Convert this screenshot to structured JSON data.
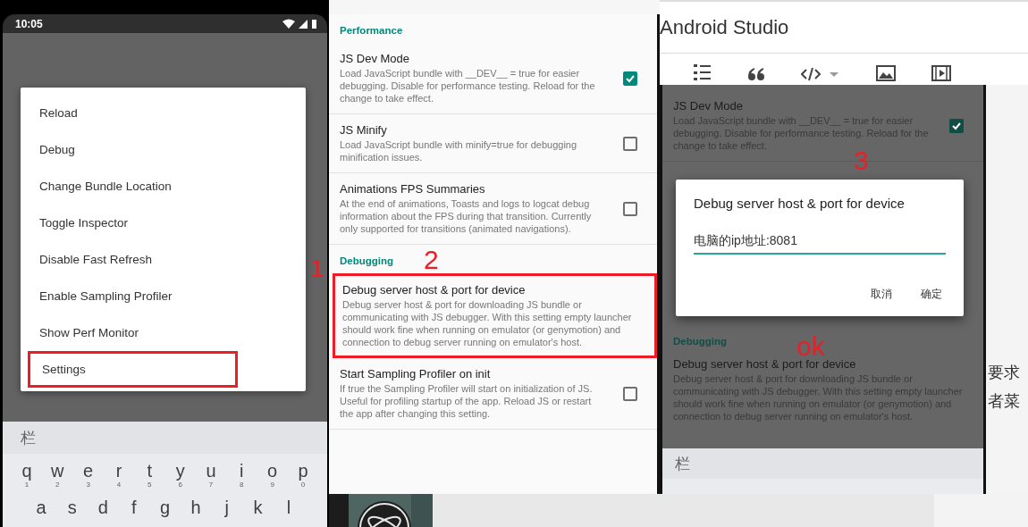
{
  "menu_screen": {
    "status_bar": {
      "time": "10:05"
    },
    "menu_items": [
      {
        "label": "Reload",
        "highlighted": false
      },
      {
        "label": "Debug",
        "highlighted": false
      },
      {
        "label": "Change Bundle Location",
        "highlighted": false
      },
      {
        "label": "Toggle Inspector",
        "highlighted": false
      },
      {
        "label": "Disable Fast Refresh",
        "highlighted": false
      },
      {
        "label": "Enable Sampling Profiler",
        "highlighted": false
      },
      {
        "label": "Show Perf Monitor",
        "highlighted": false
      },
      {
        "label": "Settings",
        "highlighted": true
      }
    ],
    "annotation": "1",
    "keyboard": {
      "suggestion": "栏",
      "rows": [
        [
          {
            "key": "q",
            "hint": "1"
          },
          {
            "key": "w",
            "hint": "2"
          },
          {
            "key": "e",
            "hint": "3"
          },
          {
            "key": "r",
            "hint": "4"
          },
          {
            "key": "t",
            "hint": "5"
          },
          {
            "key": "y",
            "hint": "6"
          },
          {
            "key": "u",
            "hint": "7"
          },
          {
            "key": "i",
            "hint": "8"
          },
          {
            "key": "o",
            "hint": "9"
          },
          {
            "key": "p",
            "hint": "0"
          }
        ],
        [
          {
            "key": "a"
          },
          {
            "key": "s"
          },
          {
            "key": "d"
          },
          {
            "key": "f"
          },
          {
            "key": "g"
          },
          {
            "key": "h"
          },
          {
            "key": "j"
          },
          {
            "key": "k"
          },
          {
            "key": "l"
          }
        ]
      ]
    }
  },
  "settings_screen": {
    "annotation": "2",
    "sections": [
      {
        "title": "Performance",
        "items": [
          {
            "kind": "toggle",
            "title": "JS Dev Mode",
            "description": "Load JavaScript bundle with __DEV__ = true for easier debugging. Disable for performance testing. Reload for the change to take effect.",
            "checked": true,
            "highlighted": false
          },
          {
            "kind": "toggle",
            "title": "JS Minify",
            "description": "Load JavaScript bundle with minify=true for debugging minification issues.",
            "checked": false,
            "highlighted": false
          },
          {
            "kind": "toggle",
            "title": "Animations FPS Summaries",
            "description": "At the end of animations, Toasts and logs to logcat debug information about the FPS during that transition. Currently only supported for transitions (animated navigations).",
            "checked": false,
            "highlighted": false
          }
        ]
      },
      {
        "title": "Debugging",
        "items": [
          {
            "kind": "text",
            "title": "Debug server host & port for device",
            "description": "Debug server host & port for downloading JS bundle or communicating with JS debugger. With this setting empty launcher should work fine when running on emulator (or genymotion) and connection to debug server running on emulator's host.",
            "highlighted": true
          },
          {
            "kind": "toggle",
            "title": "Start Sampling Profiler on init",
            "description": "If true the Sampling Profiler will start on initialization of JS. Useful for profiling startup of the app. Reload JS or restart the app after changing this setting.",
            "checked": false,
            "highlighted": false
          }
        ]
      }
    ]
  },
  "editor": {
    "title": "Android Studio",
    "side_text": [
      "要求",
      "者菜"
    ]
  },
  "dialog_screen": {
    "annotations": [
      "3",
      "ok"
    ],
    "top_item": {
      "title": "JS Dev Mode",
      "description": "Load JavaScript bundle with __DEV__ = true for easier debugging. Disable for performance testing. Reload for the change to take effect.",
      "checked": true
    },
    "dialog": {
      "title": "Debug server host & port for device",
      "value": "电脑的ip地址:8081",
      "buttons": [
        "取消",
        "确定"
      ]
    },
    "section": "Debugging",
    "item": {
      "title": "Debug server host & port for device",
      "description": "Debug server host & port for downloading JS bundle or communicating with JS debugger. With this setting empty launcher should work fine when running on emulator (or genymotion) and connection to debug server running on emulator's host."
    },
    "keyboard": {
      "suggestion": "栏"
    }
  }
}
